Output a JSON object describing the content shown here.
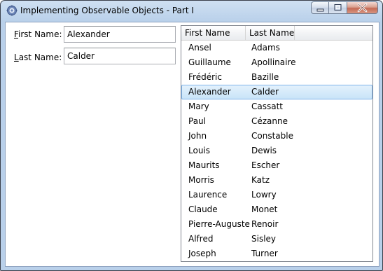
{
  "window": {
    "title": "Implementing Observable Objects - Part I",
    "icon": "gear-app-icon",
    "buttons": [
      "minimize",
      "maximize",
      "close"
    ]
  },
  "form": {
    "first_name_label": "First Name:",
    "first_name_access_key": "F",
    "first_name_label_rest": "irst Name:",
    "first_name_value": "Alexander",
    "last_name_label": "Last Name:",
    "last_name_access_key": "L",
    "last_name_label_rest": "ast Name:",
    "last_name_value": "Calder"
  },
  "list": {
    "columns": [
      "First Name",
      "Last Name"
    ],
    "selected_index": 3,
    "rows": [
      {
        "first": "Ansel",
        "last": "Adams"
      },
      {
        "first": "Guillaume",
        "last": "Apollinaire"
      },
      {
        "first": "Frédéric",
        "last": "Bazille"
      },
      {
        "first": "Alexander",
        "last": "Calder"
      },
      {
        "first": "Mary",
        "last": "Cassatt"
      },
      {
        "first": "Paul",
        "last": "Cézanne"
      },
      {
        "first": "John",
        "last": "Constable"
      },
      {
        "first": "Louis",
        "last": "Dewis"
      },
      {
        "first": "Maurits",
        "last": "Escher"
      },
      {
        "first": "Morris",
        "last": "Katz"
      },
      {
        "first": "Laurence",
        "last": "Lowry"
      },
      {
        "first": "Claude",
        "last": "Monet"
      },
      {
        "first": "Pierre-Auguste",
        "last": "Renoir"
      },
      {
        "first": "Alfred",
        "last": "Sisley"
      },
      {
        "first": "Joseph",
        "last": "Turner"
      }
    ]
  },
  "colors": {
    "selection_fill": "#cde6f9",
    "selection_border": "#7eb4ea",
    "window_frame": "#b9d0ea"
  }
}
